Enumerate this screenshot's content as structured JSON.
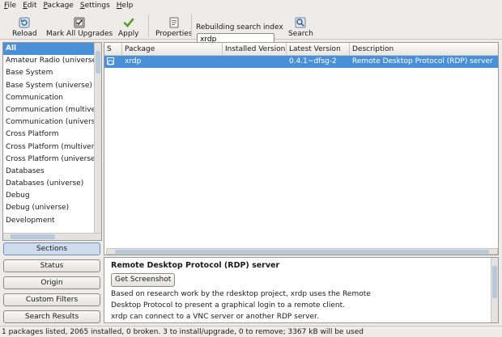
{
  "menu": [
    "File",
    "Edit",
    "Package",
    "Settings",
    "Help"
  ],
  "toolbar": {
    "reload": "Reload",
    "mark_all": "Mark All Upgrades",
    "apply": "Apply",
    "properties": "Properties",
    "search_label": "Rebuilding search index",
    "search_value": "xrdp",
    "search": "Search"
  },
  "sections": {
    "items": [
      "All",
      "Amateur Radio (universe)",
      "Base System",
      "Base System (universe)",
      "Communication",
      "Communication (multiverse)",
      "Communication (universe)",
      "Cross Platform",
      "Cross Platform (multiverse)",
      "Cross Platform (universe)",
      "Databases",
      "Databases (universe)",
      "Debug",
      "Debug (universe)",
      "Development"
    ],
    "selected": "All"
  },
  "filter_buttons": [
    "Sections",
    "Status",
    "Origin",
    "Custom Filters",
    "Search Results"
  ],
  "packages": {
    "columns": [
      "S",
      "Package",
      "Installed Version",
      "Latest Version",
      "Description"
    ],
    "rows": [
      {
        "status": "",
        "name": "xrdp",
        "installed": "",
        "latest": "0.4.1~dfsg-2",
        "description": "Remote Desktop Protocol (RDP) server"
      }
    ]
  },
  "detail": {
    "title": "Remote Desktop Protocol (RDP) server",
    "screenshot_button": "Get Screenshot",
    "lines": [
      "Based on research work by the rdesktop project, xrdp uses the Remote",
      "Desktop Protocol to present a graphical login to a remote client.",
      "xrdp can connect to a VNC server or another RDP server."
    ]
  },
  "status": "1 packages listed, 2065 installed, 0 broken. 3 to install/upgrade, 0 to remove; 3367 kB will be used",
  "colors": {
    "selection": "#4a90d9",
    "window": "#edeceb"
  }
}
